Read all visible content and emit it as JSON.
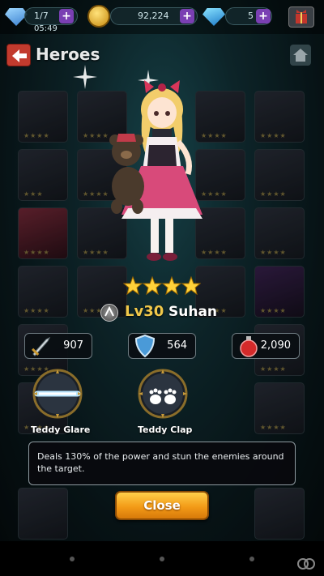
{
  "topbar": {
    "roster_count": "1/7",
    "timer": "05:49",
    "gold": "92,224",
    "gems": "5"
  },
  "header": {
    "title": "Heroes"
  },
  "hero": {
    "stars": 4,
    "level": "Lv30",
    "name": "Suhan"
  },
  "stats": {
    "attack": "907",
    "defense": "564",
    "hp": "2,090"
  },
  "skills": [
    {
      "name": "Teddy Glare",
      "icon": "sword-glare-icon"
    },
    {
      "name": "Teddy Clap",
      "icon": "paw-clap-icon"
    }
  ],
  "tooltip": {
    "text": "Deals 130% of the power and stun the enemies around the target."
  },
  "buttons": {
    "close_label": "Close"
  },
  "colors": {
    "level_gold": "#f0c84a",
    "close_orange": "#f39b17",
    "back_red": "#c23b2e",
    "plus_purple": "#7a3fb3"
  }
}
